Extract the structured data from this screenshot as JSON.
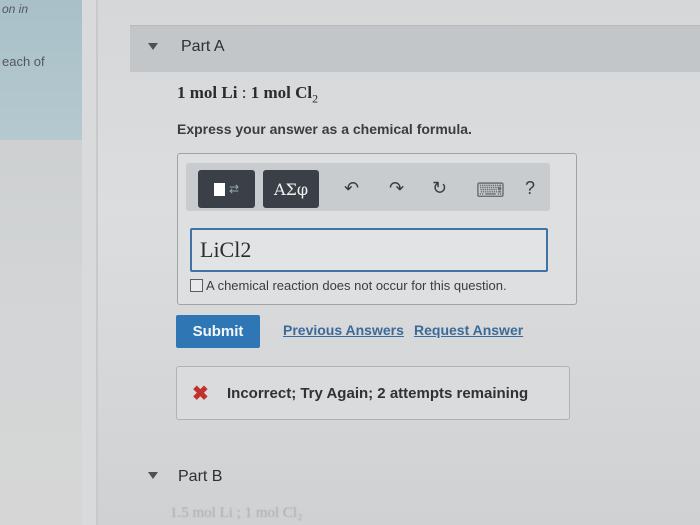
{
  "sidebar": {
    "text_top": "on in",
    "text_mid": "each of"
  },
  "partA": {
    "title": "Part A",
    "formula_part1": "1 mol Li",
    "formula_sep": " : ",
    "formula_part2": "1 mol Cl",
    "formula_sub": "2",
    "instruction": "Express your answer as a chemical formula.",
    "toolbar": {
      "template_label": "■→",
      "symbols_label": "ΑΣφ",
      "undo": "↶",
      "redo": "↷",
      "reset": "↻",
      "keyboard": "⌨",
      "help": "?"
    },
    "answer_value": "LiCl2",
    "no_reaction_label": "A chemical reaction does not occur for this question.",
    "submit_label": "Submit",
    "previous_answers_label": "Previous Answers",
    "request_answer_label": "Request Answer",
    "feedback_icon": "✖",
    "feedback_text": "Incorrect; Try Again; 2 attempts remaining"
  },
  "partB": {
    "title": "Part B",
    "formula_preview": "1.5 mol Li ; 1 mol Cl₂"
  },
  "colors": {
    "submit_bg": "#2f77b4",
    "link": "#3a6b9a",
    "error": "#c0322b",
    "input_border": "#3f73a3"
  }
}
